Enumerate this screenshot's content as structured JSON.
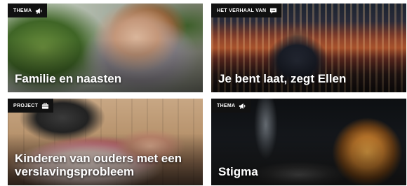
{
  "cards": [
    {
      "tag": "THEMA",
      "tag_icon": "megaphone-icon",
      "title": "Familie en naasten"
    },
    {
      "tag": "HET VERHAAL VAN",
      "tag_icon": "speech-bubble-icon",
      "title": "Je bent laat, zegt Ellen"
    },
    {
      "tag": "PROJECT",
      "tag_icon": "briefcase-icon",
      "title": "Kinderen van ouders met een verslavingsprobleem"
    },
    {
      "tag": "THEMA",
      "tag_icon": "megaphone-icon",
      "title": "Stigma"
    }
  ],
  "colors": {
    "tag_background": "#111111",
    "tag_text": "#ffffff",
    "title_text": "#ffffff"
  }
}
